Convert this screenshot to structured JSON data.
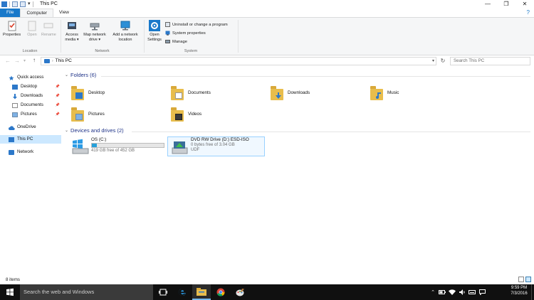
{
  "window": {
    "title": "This PC",
    "controls": {
      "minimize": "—",
      "maximize": "❐",
      "close": "✕"
    },
    "help": "?"
  },
  "ribbon": {
    "tabs": [
      "File",
      "Computer",
      "View"
    ],
    "groups": {
      "location": {
        "label": "Location",
        "properties": "Properties",
        "open": "Open",
        "rename": "Rename"
      },
      "network": {
        "label": "Network",
        "access_media": "Access media ▾",
        "map_network_drive": "Map network drive ▾",
        "add_network_location": "Add a network location"
      },
      "system": {
        "label": "System",
        "open_settings": "Open Settings",
        "uninstall": "Uninstall or change a program",
        "system_properties": "System properties",
        "manage": "Manage"
      }
    }
  },
  "address": {
    "path": "This PC",
    "search_placeholder": "Search This PC"
  },
  "nav": {
    "quick_access": "Quick access",
    "quick_items": [
      "Desktop",
      "Downloads",
      "Documents",
      "Pictures"
    ],
    "onedrive": "OneDrive",
    "this_pc": "This PC",
    "network": "Network"
  },
  "content": {
    "folders_header": "Folders (6)",
    "folders": [
      "Desktop",
      "Documents",
      "Downloads",
      "Music",
      "Pictures",
      "Videos"
    ],
    "devices_header": "Devices and drives (2)",
    "drives": [
      {
        "name": "OS (C:)",
        "free": "419 GB free of 452 GB",
        "used_fraction": 0.073
      },
      {
        "name": "DVD RW Drive (D:) ESD-ISO",
        "free": "0 bytes free of 3.04 GB",
        "fs": "UDF"
      }
    ]
  },
  "status": {
    "items": "8 items"
  },
  "taskbar": {
    "search_placeholder": "Search the web and Windows",
    "time": "9:59 PM",
    "date": "7/3/2016"
  },
  "colors": {
    "accent": "#1979ca",
    "folder": "#e8bd4c",
    "drive_bar": "#26a0da",
    "taskbar": "#101010"
  }
}
